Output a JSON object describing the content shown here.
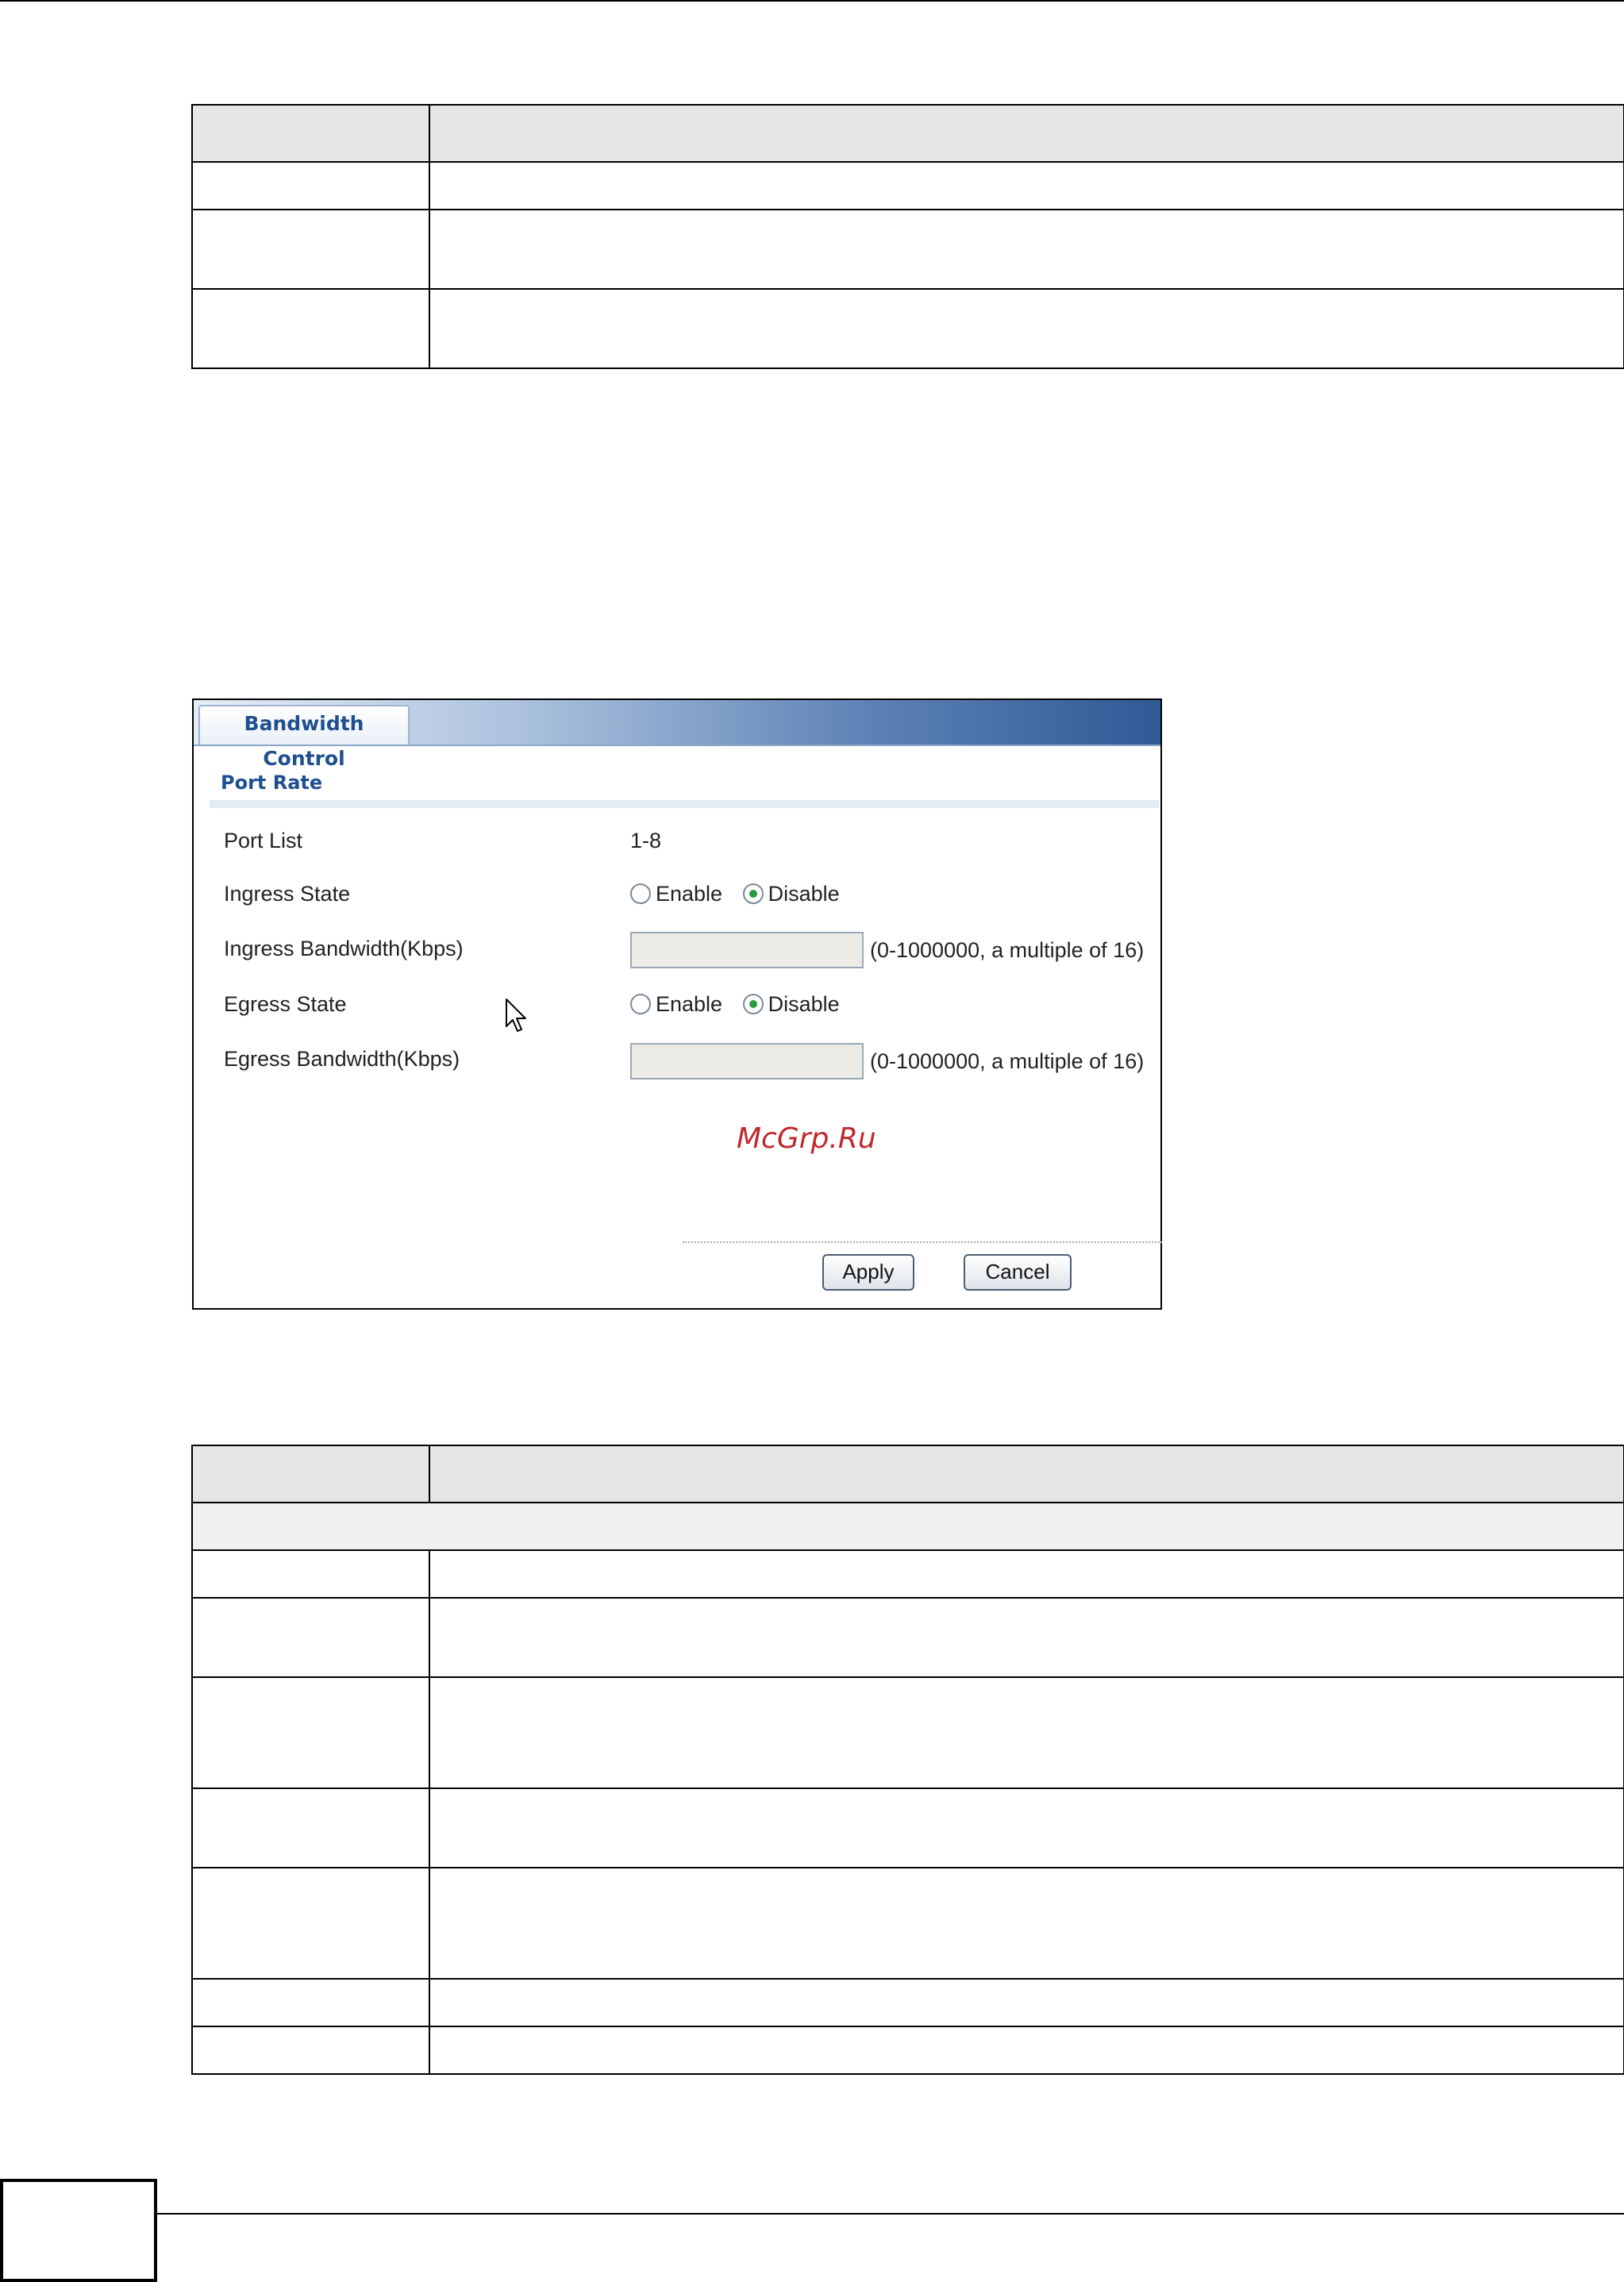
{
  "panel": {
    "tab_label": "Bandwidth Control",
    "section_title": "Port Rate",
    "rows": {
      "port_list": {
        "label": "Port List",
        "value": "1-8"
      },
      "ingress_state": {
        "label": "Ingress State",
        "enable_label": "Enable",
        "disable_label": "Disable",
        "selected": "Disable"
      },
      "ingress_bandwidth": {
        "label": "Ingress Bandwidth(Kbps)",
        "value": "",
        "hint": "(0-1000000, a multiple of 16)"
      },
      "egress_state": {
        "label": "Egress State",
        "enable_label": "Enable",
        "disable_label": "Disable",
        "selected": "Disable"
      },
      "egress_bandwidth": {
        "label": "Egress Bandwidth(Kbps)",
        "value": "",
        "hint": "(0-1000000, a multiple of 16)"
      }
    },
    "watermark": "McGrp.Ru",
    "buttons": {
      "apply": "Apply",
      "cancel": "Cancel"
    }
  },
  "colors": {
    "tab_text": "#1f4f8f",
    "radio_selected": "#2c9a3a",
    "watermark": "#c0282d"
  }
}
